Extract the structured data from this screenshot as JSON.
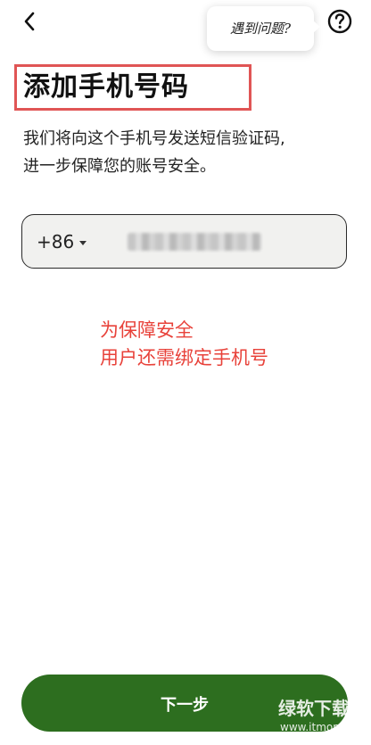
{
  "header": {
    "back_icon": "chevron-left-icon",
    "help_bubble_text": "遇到问题?",
    "help_icon": "question-circle-icon"
  },
  "page": {
    "title": "添加手机号码",
    "description_line1": "我们将向这个手机号发送短信验证码,",
    "description_line2": "进一步保障您的账号安全。"
  },
  "phone_field": {
    "country_code": "+86",
    "value_masked": true
  },
  "annotation": {
    "line1": "为保障安全",
    "line2": "用户还需绑定手机号",
    "color": "#e8423a"
  },
  "footer": {
    "next_button_label": "下一步"
  },
  "watermark": {
    "text": "绿软下载",
    "url": "www.itmop.com"
  },
  "colors": {
    "primary_button": "#2d6e1f",
    "title_highlight_border": "#e05555",
    "input_background": "#f1f1ef"
  }
}
